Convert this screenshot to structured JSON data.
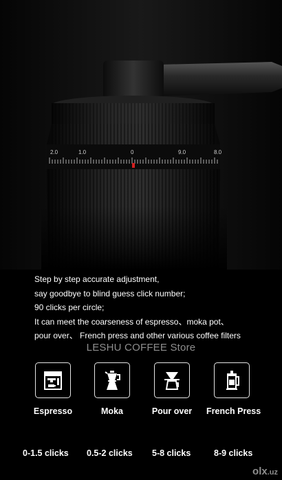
{
  "dial": {
    "labels": [
      "2.0",
      "1.0",
      "0",
      "9.0",
      "8.0"
    ]
  },
  "description": {
    "lines": [
      "Step by step accurate adjustment,",
      "say goodbye to blind guess click number;",
      "90 clicks per circle;",
      "It can meet the coarseness of espresso、moka pot、",
      "pour over、 French press and other various coffee filters"
    ]
  },
  "store": "LESHU COFFEE Store",
  "methods": [
    {
      "label": "Espresso",
      "clicks": "0-1.5 clicks",
      "icon": "espresso-machine-icon"
    },
    {
      "label": "Moka",
      "clicks": "0.5-2 clicks",
      "icon": "moka-pot-icon"
    },
    {
      "label": "Pour over",
      "clicks": "5-8 clicks",
      "icon": "pour-over-icon"
    },
    {
      "label": "French Press",
      "clicks": "8-9 clicks",
      "icon": "french-press-icon"
    }
  ],
  "watermark": {
    "text": "olx",
    "suffix": ".uz"
  },
  "colors": {
    "background": "#000000",
    "accent_marker": "#d42020",
    "store_text": "#8e8e8e"
  }
}
